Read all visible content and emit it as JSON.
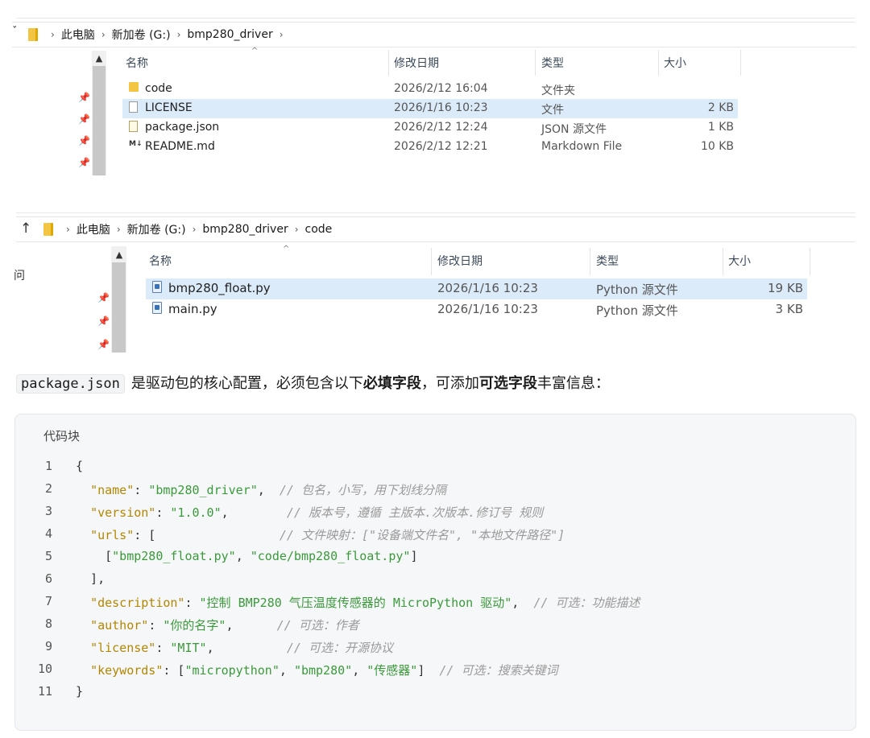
{
  "explorer1": {
    "breadcrumbs": [
      "此电脑",
      "新加卷 (G:)",
      "bmp280_driver"
    ],
    "columns": {
      "name": "名称",
      "modified": "修改日期",
      "type": "类型",
      "size": "大小"
    },
    "files": [
      {
        "name": "code",
        "modified": "2026/2/12 16:04",
        "type": "文件夹",
        "size": "",
        "icon": "folder-icon"
      },
      {
        "name": "LICENSE",
        "modified": "2026/1/16 10:23",
        "type": "文件",
        "size": "2 KB",
        "icon": "file-icon"
      },
      {
        "name": "package.json",
        "modified": "2026/2/12 12:24",
        "type": "JSON 源文件",
        "size": "1 KB",
        "icon": "json-file-icon"
      },
      {
        "name": "README.md",
        "modified": "2026/2/12 12:21",
        "type": "Markdown File",
        "size": "10 KB",
        "icon": "markdown-file-icon"
      }
    ]
  },
  "explorer2": {
    "breadcrumbs": [
      "此电脑",
      "新加卷 (G:)",
      "bmp280_driver",
      "code"
    ],
    "columns": {
      "name": "名称",
      "modified": "修改日期",
      "type": "类型",
      "size": "大小"
    },
    "files": [
      {
        "name": "bmp280_float.py",
        "modified": "2026/1/16 10:23",
        "type": "Python 源文件",
        "size": "19 KB",
        "icon": "python-file-icon"
      },
      {
        "name": "main.py",
        "modified": "2026/1/16 10:23",
        "type": "Python 源文件",
        "size": "3 KB",
        "icon": "python-file-icon"
      }
    ],
    "side_label": "问"
  },
  "paragraph": {
    "code": "package.json",
    "text1": "是驱动包的核心配置，必须包含以下",
    "bold1": "必填字段",
    "text2": "，可添加",
    "bold2": "可选字段",
    "text3": "丰富信息："
  },
  "codeblock": {
    "title": "代码块",
    "lines": [
      {
        "n": "1",
        "tokens": [
          {
            "t": "{",
            "c": "p"
          }
        ]
      },
      {
        "n": "2",
        "tokens": [
          {
            "t": "  ",
            "c": "p"
          },
          {
            "t": "\"name\"",
            "c": "k"
          },
          {
            "t": ": ",
            "c": "p"
          },
          {
            "t": "\"bmp280_driver\"",
            "c": "s"
          },
          {
            "t": ",  ",
            "c": "p"
          },
          {
            "t": "// 包名，小写，用下划线分隔",
            "c": "c"
          }
        ]
      },
      {
        "n": "3",
        "tokens": [
          {
            "t": "  ",
            "c": "p"
          },
          {
            "t": "\"version\"",
            "c": "k"
          },
          {
            "t": ": ",
            "c": "p"
          },
          {
            "t": "\"1.0.0\"",
            "c": "s"
          },
          {
            "t": ",        ",
            "c": "p"
          },
          {
            "t": "// 版本号，遵循 主版本.次版本.修订号 规则",
            "c": "c"
          }
        ]
      },
      {
        "n": "4",
        "tokens": [
          {
            "t": "  ",
            "c": "p"
          },
          {
            "t": "\"urls\"",
            "c": "k"
          },
          {
            "t": ": [                 ",
            "c": "p"
          },
          {
            "t": "// 文件映射：[\"设备端文件名\", \"本地文件路径\"]",
            "c": "c"
          }
        ]
      },
      {
        "n": "5",
        "tokens": [
          {
            "t": "    [",
            "c": "p"
          },
          {
            "t": "\"bmp280_float.py\"",
            "c": "s"
          },
          {
            "t": ", ",
            "c": "p"
          },
          {
            "t": "\"code/bmp280_float.py\"",
            "c": "s"
          },
          {
            "t": "]",
            "c": "p"
          }
        ]
      },
      {
        "n": "6",
        "tokens": [
          {
            "t": "  ],",
            "c": "p"
          }
        ]
      },
      {
        "n": "7",
        "tokens": [
          {
            "t": "  ",
            "c": "p"
          },
          {
            "t": "\"description\"",
            "c": "k"
          },
          {
            "t": ": ",
            "c": "p"
          },
          {
            "t": "\"控制 BMP280 气压温度传感器的 MicroPython 驱动\"",
            "c": "s"
          },
          {
            "t": ",  ",
            "c": "p"
          },
          {
            "t": "// 可选：功能描述",
            "c": "c"
          }
        ]
      },
      {
        "n": "8",
        "tokens": [
          {
            "t": "  ",
            "c": "p"
          },
          {
            "t": "\"author\"",
            "c": "k"
          },
          {
            "t": ": ",
            "c": "p"
          },
          {
            "t": "\"你的名字\"",
            "c": "s"
          },
          {
            "t": ",      ",
            "c": "p"
          },
          {
            "t": "// 可选：作者",
            "c": "c"
          }
        ]
      },
      {
        "n": "9",
        "tokens": [
          {
            "t": "  ",
            "c": "p"
          },
          {
            "t": "\"license\"",
            "c": "k"
          },
          {
            "t": ": ",
            "c": "p"
          },
          {
            "t": "\"MIT\"",
            "c": "s"
          },
          {
            "t": ",          ",
            "c": "p"
          },
          {
            "t": "// 可选：开源协议",
            "c": "c"
          }
        ]
      },
      {
        "n": "10",
        "tokens": [
          {
            "t": "  ",
            "c": "p"
          },
          {
            "t": "\"keywords\"",
            "c": "k"
          },
          {
            "t": ": [",
            "c": "p"
          },
          {
            "t": "\"micropython\"",
            "c": "s"
          },
          {
            "t": ", ",
            "c": "p"
          },
          {
            "t": "\"bmp280\"",
            "c": "s"
          },
          {
            "t": ", ",
            "c": "p"
          },
          {
            "t": "\"传感器\"",
            "c": "s"
          },
          {
            "t": "]  ",
            "c": "p"
          },
          {
            "t": "// 可选：搜索关键词",
            "c": "c"
          }
        ]
      },
      {
        "n": "11",
        "tokens": [
          {
            "t": "}",
            "c": "p"
          }
        ]
      }
    ]
  },
  "colors": {
    "selection": "#dcebfa",
    "key": "#b38600",
    "string": "#3a9a3a",
    "comment": "#9a9a9a"
  }
}
